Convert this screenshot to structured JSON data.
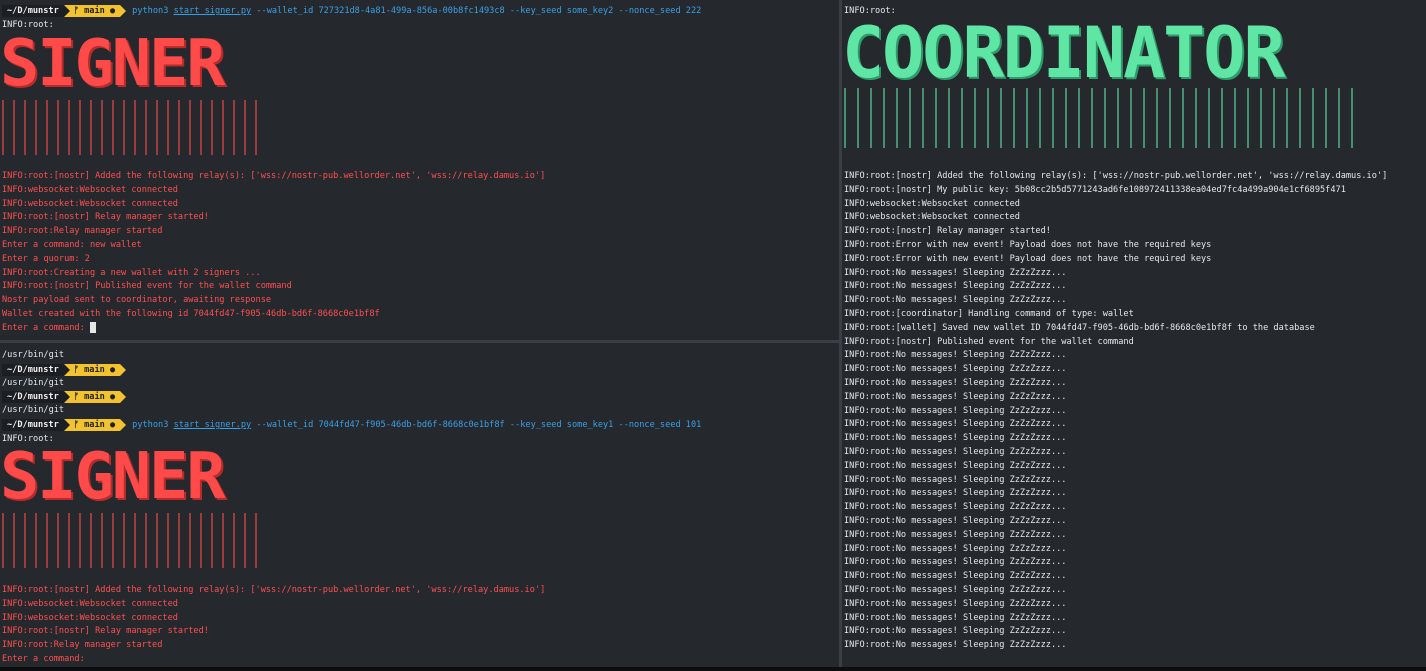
{
  "top_left": {
    "prompt": {
      "path": "~/D/munstr",
      "branch": "main",
      "cmd_python": "python3",
      "cmd_script": "start_signer.py",
      "cmd_args": "--wallet_id 727321d8-4a81-499a-856a-00b8fc1493c8 --key_seed some_key2 --nonce_seed 222"
    },
    "info_root": "INFO:root:",
    "banner": "SIGNER",
    "lines": [
      "INFO:root:[nostr] Added the following relay(s): ['wss://nostr-pub.wellorder.net', 'wss://relay.damus.io']",
      "INFO:websocket:Websocket connected",
      "INFO:websocket:Websocket connected",
      "INFO:root:[nostr] Relay manager started!",
      "INFO:root:Relay manager started",
      "Enter a command: new wallet",
      "Enter a quorum: 2",
      "INFO:root:Creating a new wallet with 2 signers ...",
      "INFO:root:[nostr] Published event for the wallet command",
      "Nostr payload sent to coordinator, awaiting response",
      "Wallet created with the following id 7044fd47-f905-46db-bd6f-8668c0e1bf8f",
      "Enter a command: "
    ]
  },
  "bottom_left": {
    "pre_lines": [
      {
        "kind": "text",
        "text": "/usr/bin/git"
      },
      {
        "kind": "prompt"
      },
      {
        "kind": "text",
        "text": "/usr/bin/git"
      },
      {
        "kind": "prompt"
      },
      {
        "kind": "text",
        "text": "/usr/bin/git"
      }
    ],
    "prompt": {
      "path": "~/D/munstr",
      "branch": "main",
      "cmd_python": "python3",
      "cmd_script": "start_signer.py",
      "cmd_args": "--wallet_id 7044fd47-f905-46db-bd6f-8668c0e1bf8f --key_seed some_key1 --nonce_seed 101"
    },
    "info_root": "INFO:root:",
    "banner": "SIGNER",
    "lines": [
      "INFO:root:[nostr] Added the following relay(s): ['wss://nostr-pub.wellorder.net', 'wss://relay.damus.io']",
      "INFO:websocket:Websocket connected",
      "INFO:websocket:Websocket connected",
      "INFO:root:[nostr] Relay manager started!",
      "INFO:root:Relay manager started",
      "Enter a command:"
    ]
  },
  "right": {
    "info_root": "INFO:root:",
    "banner": "COORDINATOR",
    "lines": [
      "INFO:root:[nostr] Added the following relay(s): ['wss://nostr-pub.wellorder.net', 'wss://relay.damus.io']",
      "INFO:root:[nostr] My public key: 5b08cc2b5d5771243ad6fe108972411338ea04ed7fc4a499a904e1cf6895f471",
      "INFO:websocket:Websocket connected",
      "INFO:websocket:Websocket connected",
      "INFO:root:[nostr] Relay manager started!",
      "INFO:root:Error with new event! Payload does not have the required keys",
      "INFO:root:Error with new event! Payload does not have the required keys",
      "INFO:root:No messages! Sleeping ZzZzZzzz...",
      "INFO:root:No messages! Sleeping ZzZzZzzz...",
      "INFO:root:No messages! Sleeping ZzZzZzzz...",
      "INFO:root:[coordinator] Handling command of type: wallet",
      "INFO:root:[wallet] Saved new wallet ID 7044fd47-f905-46db-bd6f-8668c0e1bf8f to the database",
      "INFO:root:[nostr] Published event for the wallet command",
      "INFO:root:No messages! Sleeping ZzZzZzzz...",
      "INFO:root:No messages! Sleeping ZzZzZzzz...",
      "INFO:root:No messages! Sleeping ZzZzZzzz...",
      "INFO:root:No messages! Sleeping ZzZzZzzz...",
      "INFO:root:No messages! Sleeping ZzZzZzzz...",
      "INFO:root:No messages! Sleeping ZzZzZzzz...",
      "INFO:root:No messages! Sleeping ZzZzZzzz...",
      "INFO:root:No messages! Sleeping ZzZzZzzz...",
      "INFO:root:No messages! Sleeping ZzZzZzzz...",
      "INFO:root:No messages! Sleeping ZzZzZzzz...",
      "INFO:root:No messages! Sleeping ZzZzZzzz...",
      "INFO:root:No messages! Sleeping ZzZzZzzz...",
      "INFO:root:No messages! Sleeping ZzZzZzzz...",
      "INFO:root:No messages! Sleeping ZzZzZzzz...",
      "INFO:root:No messages! Sleeping ZzZzZzzz...",
      "INFO:root:No messages! Sleeping ZzZzZzzz...",
      "INFO:root:No messages! Sleeping ZzZzZzzz...",
      "INFO:root:No messages! Sleeping ZzZzZzzz...",
      "INFO:root:No messages! Sleeping ZzZzZzzz...",
      "INFO:root:No messages! Sleeping ZzZzZzzz...",
      "INFO:root:No messages! Sleeping ZzZzZzzz...",
      "INFO:root:No messages! Sleeping ZzZzZzzz..."
    ]
  },
  "colors": {
    "signer_banner": "#ff4a4a",
    "coordinator_banner": "#5fe6a4",
    "branch_badge": "#f2c230",
    "command": "#3aa0e6",
    "background": "#25292e"
  }
}
